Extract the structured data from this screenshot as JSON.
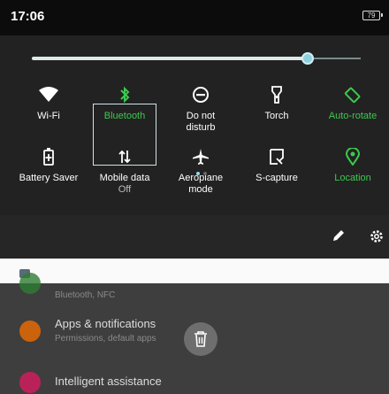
{
  "status": {
    "time": "17:06",
    "battery": "79"
  },
  "brightness": {
    "level": 0.84
  },
  "tiles": [
    {
      "label": "Wi-Fi",
      "sub": "",
      "icon": "wifi-icon",
      "active": false
    },
    {
      "label": "Bluetooth",
      "sub": "",
      "icon": "bluetooth-icon",
      "active": true
    },
    {
      "label": "Do not",
      "sub": "disturb",
      "icon": "do-not-disturb-icon",
      "active": false
    },
    {
      "label": "Torch",
      "sub": "",
      "icon": "torch-icon",
      "active": false
    },
    {
      "label": "Auto-rotate",
      "sub": "",
      "icon": "auto-rotate-icon",
      "active": true
    },
    {
      "label": "Battery Saver",
      "sub": "",
      "icon": "battery-saver-icon",
      "active": false
    },
    {
      "label": "Mobile data",
      "sub": "Off",
      "icon": "mobile-data-icon",
      "active": false
    },
    {
      "label": "Aeroplane",
      "sub": "mode",
      "icon": "aeroplane-icon",
      "active": false
    },
    {
      "label": "S-capture",
      "sub": "",
      "icon": "s-capture-icon",
      "active": false
    },
    {
      "label": "Location",
      "sub": "",
      "icon": "location-icon",
      "active": true
    }
  ],
  "pager": {
    "pages": 2,
    "current": 0
  },
  "actions": {
    "edit": "edit-icon",
    "settings": "settings-icon"
  },
  "settings_list": [
    {
      "title": "",
      "subtitle": "Bluetooth, NFC",
      "icon_color": "#2e7d32"
    },
    {
      "title": "Apps & notifications",
      "subtitle": "Permissions, default apps",
      "icon_color": "#ef6c00"
    },
    {
      "title": "Intelligent assistance",
      "subtitle": "",
      "icon_color": "#d81b60"
    }
  ],
  "colors": {
    "active": "#3dc94e",
    "accent": "#8fd0dd"
  }
}
